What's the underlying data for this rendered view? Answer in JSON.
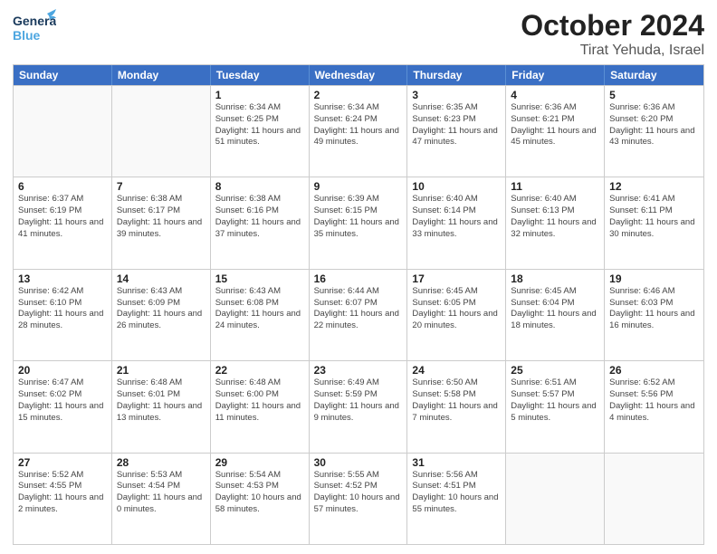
{
  "header": {
    "logo_line1": "General",
    "logo_line2": "Blue",
    "month": "October 2024",
    "location": "Tirat Yehuda, Israel"
  },
  "weekdays": [
    "Sunday",
    "Monday",
    "Tuesday",
    "Wednesday",
    "Thursday",
    "Friday",
    "Saturday"
  ],
  "rows": [
    [
      {
        "day": "",
        "sunrise": "",
        "sunset": "",
        "daylight": "",
        "empty": true
      },
      {
        "day": "",
        "sunrise": "",
        "sunset": "",
        "daylight": "",
        "empty": true
      },
      {
        "day": "1",
        "sunrise": "Sunrise: 6:34 AM",
        "sunset": "Sunset: 6:25 PM",
        "daylight": "Daylight: 11 hours and 51 minutes."
      },
      {
        "day": "2",
        "sunrise": "Sunrise: 6:34 AM",
        "sunset": "Sunset: 6:24 PM",
        "daylight": "Daylight: 11 hours and 49 minutes."
      },
      {
        "day": "3",
        "sunrise": "Sunrise: 6:35 AM",
        "sunset": "Sunset: 6:23 PM",
        "daylight": "Daylight: 11 hours and 47 minutes."
      },
      {
        "day": "4",
        "sunrise": "Sunrise: 6:36 AM",
        "sunset": "Sunset: 6:21 PM",
        "daylight": "Daylight: 11 hours and 45 minutes."
      },
      {
        "day": "5",
        "sunrise": "Sunrise: 6:36 AM",
        "sunset": "Sunset: 6:20 PM",
        "daylight": "Daylight: 11 hours and 43 minutes."
      }
    ],
    [
      {
        "day": "6",
        "sunrise": "Sunrise: 6:37 AM",
        "sunset": "Sunset: 6:19 PM",
        "daylight": "Daylight: 11 hours and 41 minutes."
      },
      {
        "day": "7",
        "sunrise": "Sunrise: 6:38 AM",
        "sunset": "Sunset: 6:17 PM",
        "daylight": "Daylight: 11 hours and 39 minutes."
      },
      {
        "day": "8",
        "sunrise": "Sunrise: 6:38 AM",
        "sunset": "Sunset: 6:16 PM",
        "daylight": "Daylight: 11 hours and 37 minutes."
      },
      {
        "day": "9",
        "sunrise": "Sunrise: 6:39 AM",
        "sunset": "Sunset: 6:15 PM",
        "daylight": "Daylight: 11 hours and 35 minutes."
      },
      {
        "day": "10",
        "sunrise": "Sunrise: 6:40 AM",
        "sunset": "Sunset: 6:14 PM",
        "daylight": "Daylight: 11 hours and 33 minutes."
      },
      {
        "day": "11",
        "sunrise": "Sunrise: 6:40 AM",
        "sunset": "Sunset: 6:13 PM",
        "daylight": "Daylight: 11 hours and 32 minutes."
      },
      {
        "day": "12",
        "sunrise": "Sunrise: 6:41 AM",
        "sunset": "Sunset: 6:11 PM",
        "daylight": "Daylight: 11 hours and 30 minutes."
      }
    ],
    [
      {
        "day": "13",
        "sunrise": "Sunrise: 6:42 AM",
        "sunset": "Sunset: 6:10 PM",
        "daylight": "Daylight: 11 hours and 28 minutes."
      },
      {
        "day": "14",
        "sunrise": "Sunrise: 6:43 AM",
        "sunset": "Sunset: 6:09 PM",
        "daylight": "Daylight: 11 hours and 26 minutes."
      },
      {
        "day": "15",
        "sunrise": "Sunrise: 6:43 AM",
        "sunset": "Sunset: 6:08 PM",
        "daylight": "Daylight: 11 hours and 24 minutes."
      },
      {
        "day": "16",
        "sunrise": "Sunrise: 6:44 AM",
        "sunset": "Sunset: 6:07 PM",
        "daylight": "Daylight: 11 hours and 22 minutes."
      },
      {
        "day": "17",
        "sunrise": "Sunrise: 6:45 AM",
        "sunset": "Sunset: 6:05 PM",
        "daylight": "Daylight: 11 hours and 20 minutes."
      },
      {
        "day": "18",
        "sunrise": "Sunrise: 6:45 AM",
        "sunset": "Sunset: 6:04 PM",
        "daylight": "Daylight: 11 hours and 18 minutes."
      },
      {
        "day": "19",
        "sunrise": "Sunrise: 6:46 AM",
        "sunset": "Sunset: 6:03 PM",
        "daylight": "Daylight: 11 hours and 16 minutes."
      }
    ],
    [
      {
        "day": "20",
        "sunrise": "Sunrise: 6:47 AM",
        "sunset": "Sunset: 6:02 PM",
        "daylight": "Daylight: 11 hours and 15 minutes."
      },
      {
        "day": "21",
        "sunrise": "Sunrise: 6:48 AM",
        "sunset": "Sunset: 6:01 PM",
        "daylight": "Daylight: 11 hours and 13 minutes."
      },
      {
        "day": "22",
        "sunrise": "Sunrise: 6:48 AM",
        "sunset": "Sunset: 6:00 PM",
        "daylight": "Daylight: 11 hours and 11 minutes."
      },
      {
        "day": "23",
        "sunrise": "Sunrise: 6:49 AM",
        "sunset": "Sunset: 5:59 PM",
        "daylight": "Daylight: 11 hours and 9 minutes."
      },
      {
        "day": "24",
        "sunrise": "Sunrise: 6:50 AM",
        "sunset": "Sunset: 5:58 PM",
        "daylight": "Daylight: 11 hours and 7 minutes."
      },
      {
        "day": "25",
        "sunrise": "Sunrise: 6:51 AM",
        "sunset": "Sunset: 5:57 PM",
        "daylight": "Daylight: 11 hours and 5 minutes."
      },
      {
        "day": "26",
        "sunrise": "Sunrise: 6:52 AM",
        "sunset": "Sunset: 5:56 PM",
        "daylight": "Daylight: 11 hours and 4 minutes."
      }
    ],
    [
      {
        "day": "27",
        "sunrise": "Sunrise: 5:52 AM",
        "sunset": "Sunset: 4:55 PM",
        "daylight": "Daylight: 11 hours and 2 minutes."
      },
      {
        "day": "28",
        "sunrise": "Sunrise: 5:53 AM",
        "sunset": "Sunset: 4:54 PM",
        "daylight": "Daylight: 11 hours and 0 minutes."
      },
      {
        "day": "29",
        "sunrise": "Sunrise: 5:54 AM",
        "sunset": "Sunset: 4:53 PM",
        "daylight": "Daylight: 10 hours and 58 minutes."
      },
      {
        "day": "30",
        "sunrise": "Sunrise: 5:55 AM",
        "sunset": "Sunset: 4:52 PM",
        "daylight": "Daylight: 10 hours and 57 minutes."
      },
      {
        "day": "31",
        "sunrise": "Sunrise: 5:56 AM",
        "sunset": "Sunset: 4:51 PM",
        "daylight": "Daylight: 10 hours and 55 minutes."
      },
      {
        "day": "",
        "sunrise": "",
        "sunset": "",
        "daylight": "",
        "empty": true
      },
      {
        "day": "",
        "sunrise": "",
        "sunset": "",
        "daylight": "",
        "empty": true
      }
    ]
  ]
}
